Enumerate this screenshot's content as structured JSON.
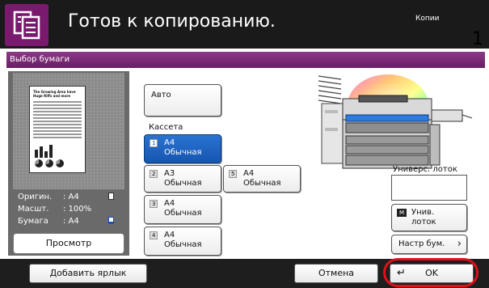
{
  "header": {
    "title": "Готов к копированию.",
    "copies_label": "Копии",
    "copies_count": "1"
  },
  "dialog": {
    "title": "Выбор бумаги"
  },
  "preview_doc": {
    "title": "The Growing Area have Huge Riffs and more"
  },
  "info": [
    {
      "key": "Оригин.",
      "value": ": A4"
    },
    {
      "key": "Масшт.",
      "value": ": 100%"
    },
    {
      "key": "Бумага",
      "value": ": A4"
    }
  ],
  "preview_button": "Просмотр",
  "paper": {
    "auto_label": "Авто",
    "kassette_label": "Кассета",
    "trays": [
      {
        "num": "1",
        "size": "A4",
        "type": "Обычная",
        "selected": true
      },
      {
        "num": "2",
        "size": "A3",
        "type": "Обычная",
        "selected": false
      },
      {
        "num": "3",
        "size": "A4",
        "type": "Обычная",
        "selected": false
      },
      {
        "num": "4",
        "size": "A4",
        "type": "Обычная",
        "selected": false
      },
      {
        "num": "5",
        "size": "A4",
        "type": "Обычная",
        "selected": false
      }
    ],
    "multi_tray_label": "Универс. лоток",
    "multi_button_num": "M",
    "multi_button_l1": "Унив.",
    "multi_button_l2": "лоток",
    "settings_button": "Настр бум."
  },
  "bottom": {
    "add_shortcut": "Добавить ярлык",
    "cancel": "Отмена",
    "ok": "OK"
  },
  "colors": {
    "header_bg": "#1a1a1a",
    "accent_purple": "#7a1a6e",
    "selected_blue": "#1556b0",
    "ok_highlight": "#e0101a"
  }
}
